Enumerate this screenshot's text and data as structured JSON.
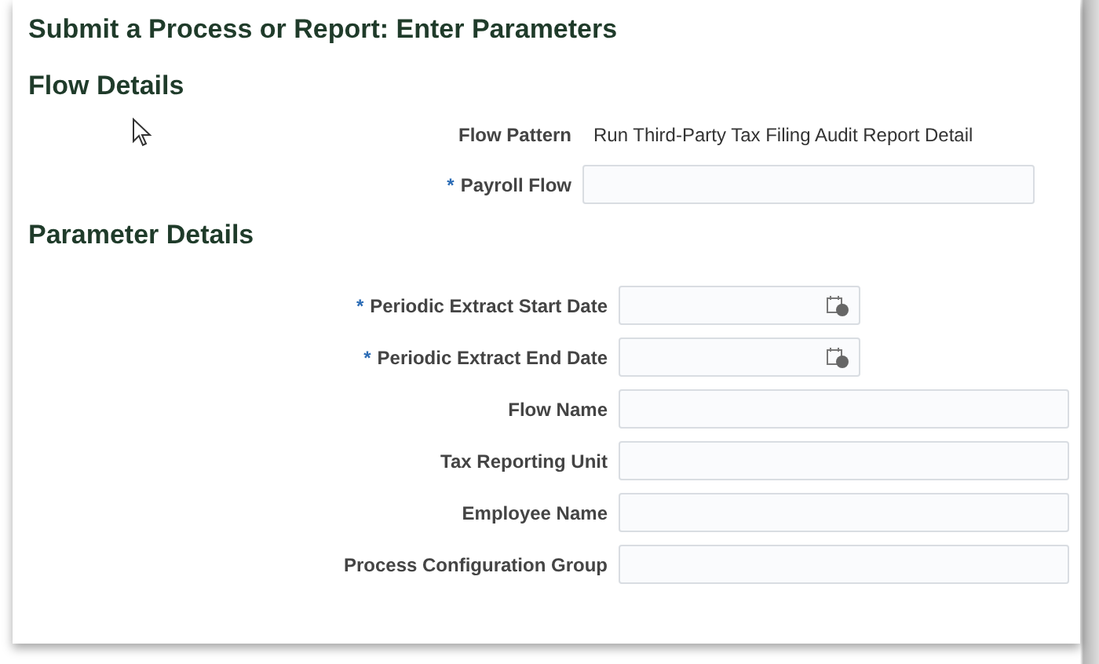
{
  "title": "Submit a Process or Report: Enter Parameters",
  "required_mark": "*",
  "flow_details": {
    "heading": "Flow Details",
    "fields": [
      {
        "kind": "text",
        "label": "Flow Pattern",
        "value": "Run Third-Party Tax Filing Audit Report Detail",
        "required": false
      },
      {
        "kind": "input",
        "label": "Payroll Flow",
        "required": true
      }
    ]
  },
  "parameter_details": {
    "heading": "Parameter Details",
    "fields": [
      {
        "kind": "date",
        "label": "Periodic Extract Start Date",
        "required": true
      },
      {
        "kind": "date",
        "label": "Periodic Extract End Date",
        "required": true
      },
      {
        "kind": "input",
        "label": "Flow Name",
        "required": false
      },
      {
        "kind": "input",
        "label": "Tax Reporting Unit",
        "required": false
      },
      {
        "kind": "input",
        "label": "Employee Name",
        "required": false
      },
      {
        "kind": "input",
        "label": "Process Configuration Group",
        "required": false
      }
    ]
  }
}
